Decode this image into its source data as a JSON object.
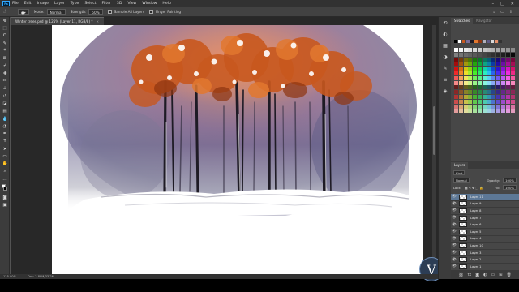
{
  "menubar": {
    "logo": "Ps",
    "items": [
      "File",
      "Edit",
      "Image",
      "Layer",
      "Type",
      "Select",
      "Filter",
      "3D",
      "View",
      "Window",
      "Help"
    ],
    "window_controls": [
      "–",
      "□",
      "✕"
    ]
  },
  "options_bar": {
    "mode_label": "Mode:",
    "mode_value": "Normal",
    "strength_label": "Strength:",
    "strength_value": "50%",
    "sample_all_layers": "Sample All Layers",
    "finger_painting": "Finger Painting"
  },
  "document": {
    "tab_title": "Winter trees.psd @ 125% (Layer 11, RGB/8) *",
    "close_glyph": "×"
  },
  "statusbar": {
    "zoom": "125.00%",
    "doc_info": "Doc: 2.88M/33.2M"
  },
  "watermark": {
    "letter": "V"
  },
  "panels": {
    "tabs": [
      "Swatches",
      "Navigator"
    ],
    "layers_tab": "Layers",
    "kind_label": "Kind",
    "blend_mode": "Normal",
    "opacity_label": "Opacity:",
    "opacity_value": "100%",
    "lock_label": "Lock:",
    "fill_label": "Fill:",
    "fill_value": "100%",
    "layers": [
      "Layer 11",
      "Layer 9",
      "Layer 8",
      "Layer 7",
      "Layer 6",
      "Layer 5",
      "Layer 4",
      "Layer 10",
      "Layer 3",
      "Layer 2",
      "Layer 1"
    ],
    "selected_index": 0
  },
  "colors": {
    "accent_selection": "#5d7896",
    "app_bg": "#535353",
    "tree_orange": "#c8581e",
    "sky_purple": "#7b6e98",
    "trunk_dark": "#1e1b25"
  }
}
